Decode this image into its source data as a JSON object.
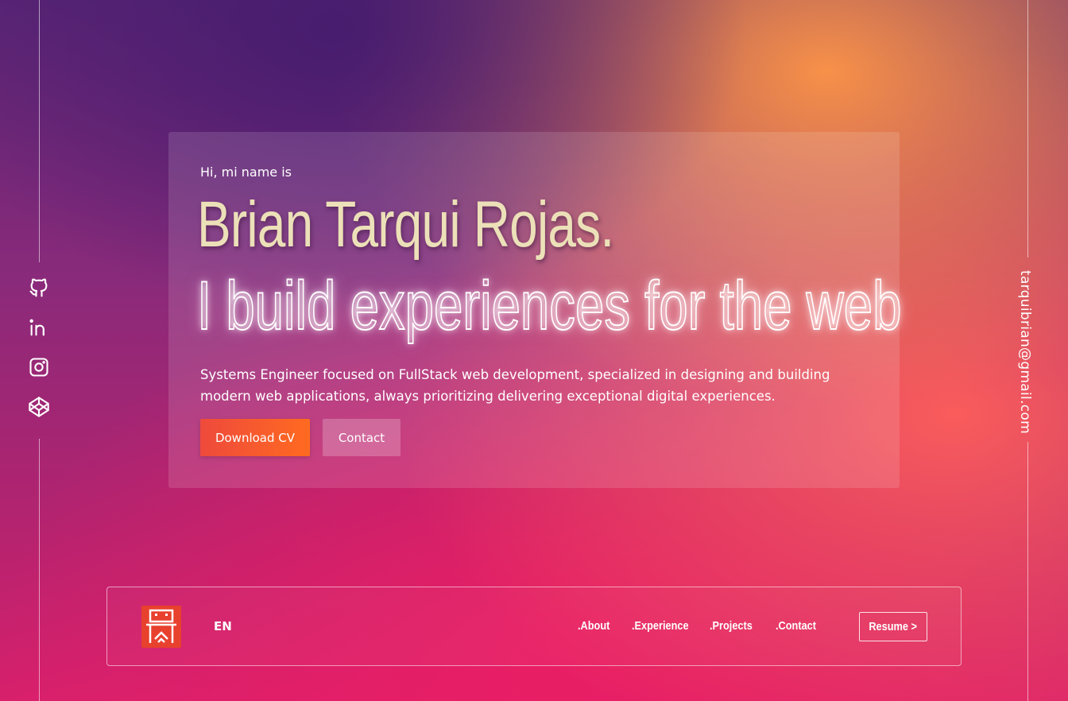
{
  "social": [
    {
      "icon": "github-icon"
    },
    {
      "icon": "linkedin-icon"
    },
    {
      "icon": "instagram-icon"
    },
    {
      "icon": "codepen-icon"
    }
  ],
  "email": "tarquibrian@gmail.com",
  "hero": {
    "greeting": "Hi, mi name is",
    "name": "Brian Tarqui Rojas.",
    "tagline": "I build experiences for the web",
    "description": "Systems Engineer focused on FullStack web development, specialized in designing and building modern web applications, always prioritizing delivering exceptional digital experiences.",
    "download_cv": "Download CV",
    "contact": "Contact"
  },
  "nav": {
    "lang": "EN",
    "links": [
      ".About",
      ".Experience",
      ".Projects",
      ".Contact"
    ],
    "resume": "Resume >"
  },
  "colors": {
    "accent": "#ee4a3c",
    "name_color": "#ece0b8"
  }
}
